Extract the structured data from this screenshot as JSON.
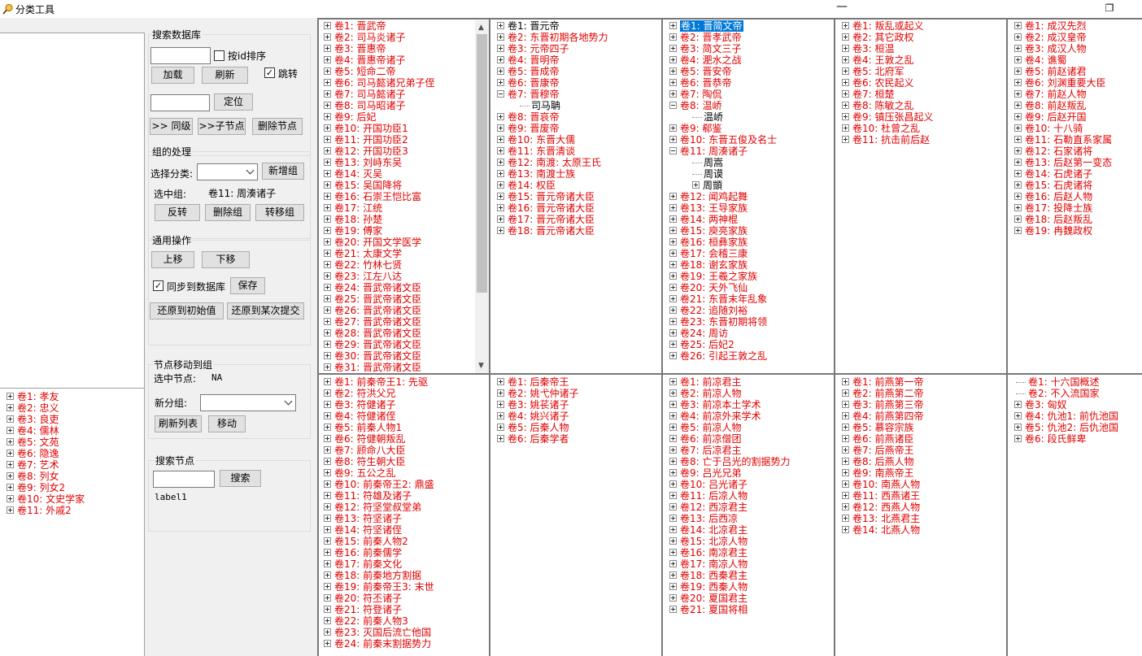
{
  "window": {
    "title": "分类工具",
    "maximize_glyph": "❐"
  },
  "controls": {
    "search_db_title": "搜索数据库",
    "sort_by_id": "按id排序",
    "load": "加载",
    "refresh": "刷新",
    "jump": "跳转",
    "locate": "定位",
    "same_level": ">> 同级",
    "child_node": ">>子节点",
    "delete_node": "删除节点",
    "group_title": "组的处理",
    "select_category": "选择分类:",
    "add_group": "新增组",
    "selected_group_label": "选中组:",
    "selected_group_value": "卷11:  周湊诸子",
    "reverse": "反转",
    "delete_group": "删除组",
    "transfer_group": "转移组",
    "common_title": "通用操作",
    "move_up": "上移",
    "move_down": "下移",
    "sync_db": "同步到数据库",
    "save": "保存",
    "restore_initial": "还原到初始值",
    "restore_commit": "还原到某次提交",
    "move_title": "节点移动到组",
    "selected_node_label": "选中节点:",
    "selected_node_value": "NA",
    "new_group": "新分组:",
    "refresh_list": "刷新列表",
    "move": "移动",
    "search_node_title": "搜索节点",
    "search": "搜索",
    "label1": "label1"
  },
  "left_tree": [
    "卷1:  孝友",
    "卷2:  忠义",
    "卷3:  良吏",
    "卷4:  儒林",
    "卷5:  文苑",
    "卷6:  隐逸",
    "卷7:  艺术",
    "卷8:  列女",
    "卷9:  列女2",
    "卷10:  文史学家",
    "卷11:  外戚2"
  ],
  "panels": [
    {
      "items": [
        {
          "t": "卷1:  晋武帝"
        },
        {
          "t": "卷2:  司马炎诸子"
        },
        {
          "t": "卷3:  晋惠帝"
        },
        {
          "t": "卷4:  晋惠帝诸子"
        },
        {
          "t": "卷5:  短命二帝"
        },
        {
          "t": "卷6:  司马懿诸兄弟子侄"
        },
        {
          "t": "卷7:  司马懿诸子"
        },
        {
          "t": "卷8:  司马昭诸子"
        },
        {
          "t": "卷9:  后妃"
        },
        {
          "t": "卷10:  开国功臣1"
        },
        {
          "t": "卷11:  开国功臣2"
        },
        {
          "t": "卷12:  开国功臣3"
        },
        {
          "t": "卷13:  刘峙东吴"
        },
        {
          "t": "卷14:  灭吴"
        },
        {
          "t": "卷15:  吴国降将"
        },
        {
          "t": "卷16:  石崇王恺比富"
        },
        {
          "t": "卷17:  江统"
        },
        {
          "t": "卷18:  孙楚"
        },
        {
          "t": "卷19:  傅家"
        },
        {
          "t": "卷20:  开国文学医学"
        },
        {
          "t": "卷21:  太康文学"
        },
        {
          "t": "卷22:  竹林七贤"
        },
        {
          "t": "卷23:  江左八达"
        },
        {
          "t": "卷24:  晋武帝诸文臣"
        },
        {
          "t": "卷25:  晋武帝诸文臣"
        },
        {
          "t": "卷26:  晋武帝诸文臣"
        },
        {
          "t": "卷27:  晋武帝诸文臣"
        },
        {
          "t": "卷28:  晋武帝诸文臣"
        },
        {
          "t": "卷29:  晋武帝诸文臣"
        },
        {
          "t": "卷30:  晋武帝诸文臣"
        },
        {
          "t": "卷31:  晋武帝诸文臣"
        }
      ]
    },
    {
      "items": [
        {
          "t": "卷1:  晋元帝",
          "c": "black"
        },
        {
          "t": "卷2:  东晋初期各地势力"
        },
        {
          "t": "卷3:  元帝四子"
        },
        {
          "t": "卷4:  晋明帝"
        },
        {
          "t": "卷5:  晋成帝"
        },
        {
          "t": "卷6:  晋康帝"
        },
        {
          "t": "卷7:  晋穆帝",
          "open": true
        },
        {
          "t": "司马聃",
          "child": true
        },
        {
          "t": "卷8:  晋哀帝"
        },
        {
          "t": "卷9:  晋废帝"
        },
        {
          "t": "卷10:  东晋大儒"
        },
        {
          "t": "卷11:  东晋清谈"
        },
        {
          "t": "卷12:  南渡: 太原王氏"
        },
        {
          "t": "卷13:  南渡士族"
        },
        {
          "t": "卷14:  权臣"
        },
        {
          "t": "卷15:  晋元帝诸大臣"
        },
        {
          "t": "卷16:  晋元帝诸大臣"
        },
        {
          "t": "卷17:  晋元帝诸大臣"
        },
        {
          "t": "卷18:  晋元帝诸大臣"
        }
      ]
    },
    {
      "items": [
        {
          "t": "卷1:  晋简文帝",
          "c": "sel"
        },
        {
          "t": "卷2:  晋孝武帝"
        },
        {
          "t": "卷3:  简文三子"
        },
        {
          "t": "卷4:  淝水之战"
        },
        {
          "t": "卷5:  晋安帝"
        },
        {
          "t": "卷6:  晋恭帝"
        },
        {
          "t": "卷7:  陶侃"
        },
        {
          "t": "卷8:  温峤",
          "open": true
        },
        {
          "t": "温峤",
          "child": true
        },
        {
          "t": "卷9:  郗鉴"
        },
        {
          "t": "卷10:  东晋五俊及名士"
        },
        {
          "t": "卷11:  周湊诸子",
          "open": true
        },
        {
          "t": "周嵩",
          "child": true
        },
        {
          "t": "周谟",
          "child": true
        },
        {
          "t": "周顗",
          "child": true,
          "plus": true
        },
        {
          "t": "卷12:  闻鸡起舞"
        },
        {
          "t": "卷13:  王导家族"
        },
        {
          "t": "卷14:  两神棍"
        },
        {
          "t": "卷15:  庾亮家族"
        },
        {
          "t": "卷16:  桓彝家族"
        },
        {
          "t": "卷17:  会稽三康"
        },
        {
          "t": "卷18:  谢玄家族"
        },
        {
          "t": "卷19:  王羲之家族"
        },
        {
          "t": "卷20:  天外飞仙"
        },
        {
          "t": "卷21:  东晋末年乱象"
        },
        {
          "t": "卷22:  追随刘裕"
        },
        {
          "t": "卷23:  东晋初期将领"
        },
        {
          "t": "卷24:  周访"
        },
        {
          "t": "卷25:  后妃2"
        },
        {
          "t": "卷26:  引起王敦之乱"
        }
      ]
    },
    {
      "items": [
        {
          "t": "卷1:  叛乱或起义"
        },
        {
          "t": "卷2:  其它政权"
        },
        {
          "t": "卷3:  桓温"
        },
        {
          "t": "卷4:  王敦之乱"
        },
        {
          "t": "卷5:  北府军"
        },
        {
          "t": "卷6:  农民起义"
        },
        {
          "t": "卷7:  桓楚"
        },
        {
          "t": "卷8:  陈敏之乱"
        },
        {
          "t": "卷9:  镇压张昌起义"
        },
        {
          "t": "卷10:  杜曾之乱"
        },
        {
          "t": "卷11:  抗击前后赵"
        }
      ]
    },
    {
      "items": [
        {
          "t": "卷1:  成汉先烈"
        },
        {
          "t": "卷2:  成汉皇帝"
        },
        {
          "t": "卷3:  成汉人物"
        },
        {
          "t": "卷4:  谯蜀"
        },
        {
          "t": "卷5:  前赵诸君"
        },
        {
          "t": "卷6:  刘渊重要大臣"
        },
        {
          "t": "卷7:  前赵人物"
        },
        {
          "t": "卷8:  前赵叛乱"
        },
        {
          "t": "卷9:  后赵开国"
        },
        {
          "t": "卷10:  十八骑"
        },
        {
          "t": "卷11:  石勒直系家属"
        },
        {
          "t": "卷12:  石家诸将"
        },
        {
          "t": "卷13:  后赵第一变态"
        },
        {
          "t": "卷14:  石虎诸子"
        },
        {
          "t": "卷15:  石虎诸将"
        },
        {
          "t": "卷16:  后赵人物"
        },
        {
          "t": "卷17:  投降士族"
        },
        {
          "t": "卷18:  后赵叛乱"
        },
        {
          "t": "卷19:  冉魏政权"
        }
      ]
    },
    {
      "items": [
        {
          "t": "卷1:  前秦帝王1: 先驱"
        },
        {
          "t": "卷2:  符洪父兄"
        },
        {
          "t": "卷3:  符健诸子"
        },
        {
          "t": "卷4:  符健诸侄"
        },
        {
          "t": "卷5:  前秦人物1"
        },
        {
          "t": "卷6:  符健朝叛乱"
        },
        {
          "t": "卷7:  顾命八大臣"
        },
        {
          "t": "卷8:  符生朝大臣"
        },
        {
          "t": "卷9:  五公之乱"
        },
        {
          "t": "卷10:  前秦帝王2: 鼎盛"
        },
        {
          "t": "卷11:  符雄及诸子"
        },
        {
          "t": "卷12:  符坚堂叔堂弟"
        },
        {
          "t": "卷13:  符坚诸子"
        },
        {
          "t": "卷14:  符坚诸侄"
        },
        {
          "t": "卷15:  前秦人物2"
        },
        {
          "t": "卷16:  前秦儒学"
        },
        {
          "t": "卷17:  前秦文化"
        },
        {
          "t": "卷18:  前秦地方割据"
        },
        {
          "t": "卷19:  前秦帝王3: 末世"
        },
        {
          "t": "卷20:  符丕诸子"
        },
        {
          "t": "卷21:  符登诸子"
        },
        {
          "t": "卷22:  前秦人物3"
        },
        {
          "t": "卷23:  灭国后流亡他国"
        },
        {
          "t": "卷24:  前秦末割据势力"
        }
      ]
    },
    {
      "items": [
        {
          "t": "卷1:  后秦帝王"
        },
        {
          "t": "卷2:  姚弋仲诸子"
        },
        {
          "t": "卷3:  姚苌诸子"
        },
        {
          "t": "卷4:  姚兴诸子"
        },
        {
          "t": "卷5:  后秦人物"
        },
        {
          "t": "卷6:  后秦学者"
        }
      ]
    },
    {
      "items": [
        {
          "t": "卷1:  前凉君主"
        },
        {
          "t": "卷2:  前凉人物"
        },
        {
          "t": "卷3:  前凉本土学术"
        },
        {
          "t": "卷4:  前凉外来学术"
        },
        {
          "t": "卷5:  前凉人物"
        },
        {
          "t": "卷6:  前凉僧团"
        },
        {
          "t": "卷7:  后凉君主"
        },
        {
          "t": "卷8:  亡于吕光的割据势力"
        },
        {
          "t": "卷9:  吕光兄弟"
        },
        {
          "t": "卷10:  吕光诸子"
        },
        {
          "t": "卷11:  后凉人物"
        },
        {
          "t": "卷12:  西凉君主"
        },
        {
          "t": "卷13:  后西凉"
        },
        {
          "t": "卷14:  北凉君主"
        },
        {
          "t": "卷15:  北凉人物"
        },
        {
          "t": "卷16:  南凉君主"
        },
        {
          "t": "卷17:  南凉人物"
        },
        {
          "t": "卷18:  西秦君主"
        },
        {
          "t": "卷19:  西秦人物"
        },
        {
          "t": "卷20:  夏国君主"
        },
        {
          "t": "卷21:  夏国将相"
        }
      ]
    },
    {
      "items": [
        {
          "t": "卷1:  前燕第一帝"
        },
        {
          "t": "卷2:  前燕第二帝"
        },
        {
          "t": "卷3:  前燕第三帝"
        },
        {
          "t": "卷4:  前燕第四帝"
        },
        {
          "t": "卷5:  慕容宗族"
        },
        {
          "t": "卷6:  前燕诸臣"
        },
        {
          "t": "卷7:  后燕帝王"
        },
        {
          "t": "卷8:  后燕人物"
        },
        {
          "t": "卷9:  南燕帝王"
        },
        {
          "t": "卷10:  南燕人物"
        },
        {
          "t": "卷11:  西燕诸王"
        },
        {
          "t": "卷12:  西燕人物"
        },
        {
          "t": "卷13:  北燕君主"
        },
        {
          "t": "卷14:  北燕人物"
        }
      ]
    },
    {
      "items": [
        {
          "t": "卷1:  十六国概述",
          "noexp": true
        },
        {
          "t": "卷2:  不入流国家",
          "noexp": true
        },
        {
          "t": "卷3:  匈奴"
        },
        {
          "t": "卷4:  仇池1: 前仇池国"
        },
        {
          "t": "卷5:  仇池2: 后仇池国"
        },
        {
          "t": "卷6:  段氏鲜卑"
        }
      ]
    }
  ]
}
